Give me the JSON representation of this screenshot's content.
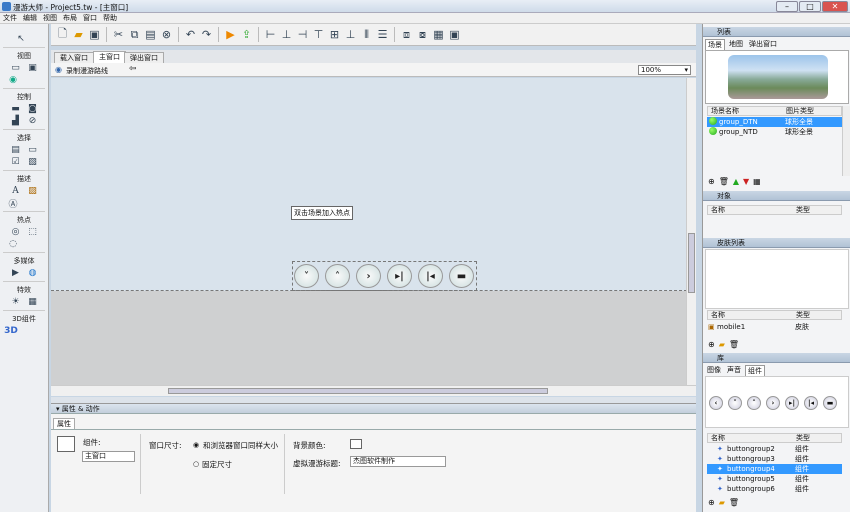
{
  "window": {
    "title": "漫游大师 - Project5.tw - [主窗口]",
    "min": "–",
    "max": "□",
    "close": "✕"
  },
  "menu": [
    "文件",
    "编辑",
    "视图",
    "布局",
    "窗口",
    "帮助"
  ],
  "left_panel": {
    "sections": [
      {
        "title": "视图",
        "icons": [
          "rect-icon",
          "image-icon",
          "globe-icon"
        ]
      },
      {
        "title": "控制",
        "icons": [
          "button-icon",
          "stop-icon",
          "chart-icon",
          "cancel-icon"
        ]
      },
      {
        "title": "选择",
        "icons": [
          "image-list-icon",
          "combo-icon",
          "check-icon",
          "picture-icon"
        ]
      },
      {
        "title": "描述",
        "icons": [
          "text-icon",
          "note-icon",
          "text-box-icon"
        ]
      },
      {
        "title": "热点",
        "icons": [
          "target-icon",
          "dotted-rect-icon",
          "ring-icon"
        ]
      },
      {
        "title": "多媒体",
        "icons": [
          "video-icon",
          "compass-icon"
        ]
      },
      {
        "title": "特效",
        "icons": [
          "sun-icon",
          "grid-icon"
        ]
      },
      {
        "title": "3D组件",
        "icons": [
          "three-d-icon"
        ]
      }
    ]
  },
  "tabs": [
    "载入窗口",
    "主窗口",
    "弹出窗口"
  ],
  "subbar": {
    "record_label": "录制漫游路线",
    "zoom": "100%"
  },
  "canvas": {
    "tooltip": "双击场景加入热点",
    "nav_buttons": [
      "˅",
      "˄",
      "›",
      "▸|",
      "|◂",
      "▬"
    ]
  },
  "properties": {
    "header": "属性 & 动作",
    "tab": "属性",
    "component_label": "组件:",
    "component_value": "主窗口",
    "window_size_label": "窗口尺寸:",
    "radio1": "和浏览器窗口同样大小",
    "radio2": "固定尺寸",
    "bg_color_label": "背景颜色:",
    "tour_title_label": "虚拟漫游标题:",
    "tour_title_value": "杰图软件制作"
  },
  "right_panel": {
    "list_header": "列表",
    "list_tabs": [
      "场景",
      "地图",
      "弹出窗口"
    ],
    "scene_cols": [
      "场景名称",
      "图片类型"
    ],
    "scenes": [
      {
        "name": "group_DTN",
        "type": "球形全景",
        "selected": true
      },
      {
        "name": "group_NTD",
        "type": "球形全景",
        "selected": false
      }
    ],
    "objects_header": "对象",
    "objects_cols": [
      "名称",
      "类型"
    ],
    "skin_header": "皮肤列表",
    "skin_cols": [
      "名称",
      "类型"
    ],
    "skins": [
      {
        "name": "mobile1",
        "type": "皮肤"
      }
    ],
    "library_header": "库",
    "library_tabs": [
      "图像",
      "声音",
      "组件"
    ],
    "lib_cols": [
      "名称",
      "类型"
    ],
    "components": [
      {
        "name": "buttongroup2",
        "type": "组件",
        "selected": false
      },
      {
        "name": "buttongroup3",
        "type": "组件",
        "selected": false
      },
      {
        "name": "buttongroup4",
        "type": "组件",
        "selected": true
      },
      {
        "name": "buttongroup5",
        "type": "组件",
        "selected": false
      },
      {
        "name": "buttongroup6",
        "type": "组件",
        "selected": false
      }
    ],
    "lib_buttons": [
      "‹",
      "˅",
      "˄",
      "›",
      "▸|",
      "|◂",
      "▬"
    ]
  },
  "colors": {
    "selection": "#3399ff",
    "panel_header": "#c3cfdc",
    "canvas_top": "#d9e3ec"
  }
}
